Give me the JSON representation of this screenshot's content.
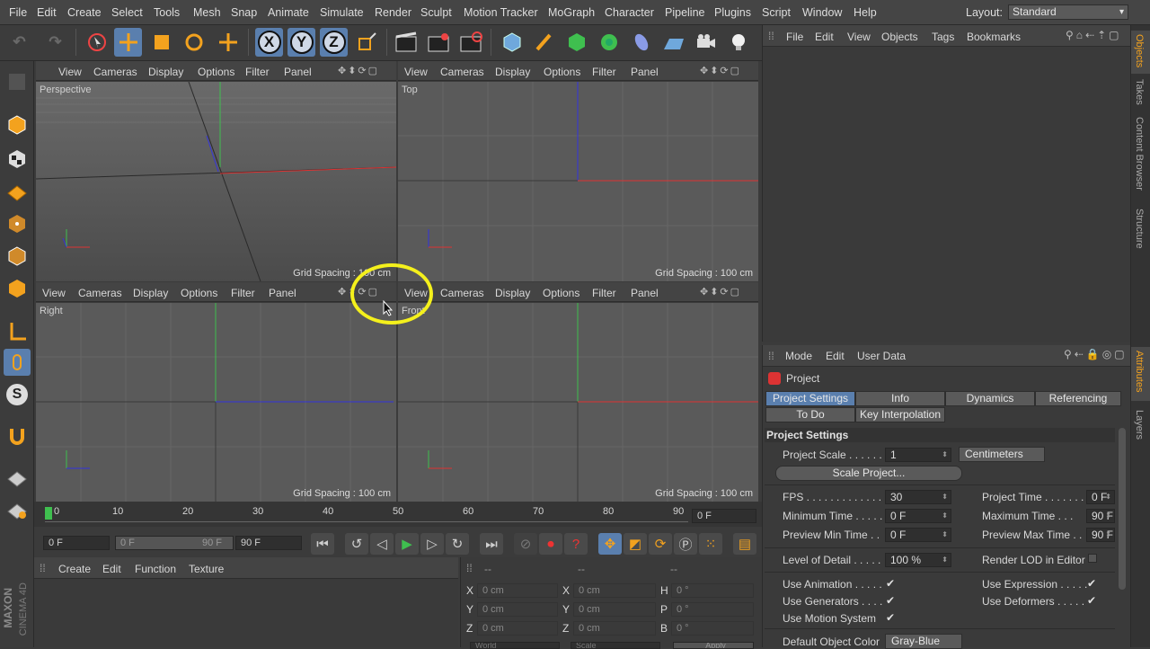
{
  "menubar": {
    "items": [
      "File",
      "Edit",
      "Create",
      "Select",
      "Tools",
      "Mesh",
      "Snap",
      "Animate",
      "Simulate",
      "Render",
      "Sculpt",
      "Motion Tracker",
      "MoGraph",
      "Character",
      "Pipeline",
      "Plugins",
      "Script",
      "Window",
      "Help"
    ],
    "layout_label": "Layout:",
    "layout_value": "Standard"
  },
  "toolbar": {
    "x": "X",
    "y": "Y",
    "z": "Z"
  },
  "viewport_menu": [
    "View",
    "Cameras",
    "Display",
    "Options",
    "Filter",
    "Panel"
  ],
  "viewports": [
    {
      "name": "Perspective",
      "grid": "Grid Spacing : 100 cm"
    },
    {
      "name": "Top",
      "grid": "Grid Spacing : 100 cm"
    },
    {
      "name": "Right",
      "grid": "Grid Spacing : 100 cm"
    },
    {
      "name": "Front",
      "grid": "Grid Spacing : 100 cm"
    }
  ],
  "timeline": {
    "ticks": [
      "0",
      "10",
      "20",
      "30",
      "40",
      "50",
      "60",
      "70",
      "80",
      "90"
    ],
    "current": "0 F"
  },
  "playback": {
    "start": "0 F",
    "range_start": "0 F",
    "range_end": "90 F",
    "end": "90 F"
  },
  "material_menu": [
    "Create",
    "Edit",
    "Function",
    "Texture"
  ],
  "coords": {
    "header": [
      "--",
      "--",
      "--"
    ],
    "rows": [
      {
        "a": "X",
        "av": "0 cm",
        "b": "X",
        "bv": "0 cm",
        "c": "H",
        "cv": "0 °"
      },
      {
        "a": "Y",
        "av": "0 cm",
        "b": "Y",
        "bv": "0 cm",
        "c": "P",
        "cv": "0 °"
      },
      {
        "a": "Z",
        "av": "0 cm",
        "b": "Z",
        "bv": "0 cm",
        "c": "B",
        "cv": "0 °"
      }
    ],
    "buttons": [
      "World",
      "Scale",
      "Apply"
    ]
  },
  "objmgr": {
    "menu": [
      "File",
      "Edit",
      "View",
      "Objects",
      "Tags",
      "Bookmarks"
    ]
  },
  "attr": {
    "menu": [
      "Mode",
      "Edit",
      "User Data"
    ],
    "title": "Project",
    "tabs1": [
      "Project Settings",
      "Info",
      "Dynamics",
      "Referencing"
    ],
    "tabs2": [
      "To Do",
      "Key Interpolation"
    ],
    "section": "Project Settings",
    "scale_label": "Project Scale . . . . . . .",
    "scale_value": "1",
    "scale_unit": "Centimeters",
    "scale_btn": "Scale Project...",
    "fps_label": "FPS . . . . . . . . . . . . . . .",
    "fps": "30",
    "ptime_label": "Project Time . . . . . . .",
    "ptime": "0 F",
    "mintime_label": "Minimum Time . . . . .",
    "mintime": "0 F",
    "maxtime_label": "Maximum Time . . .",
    "maxtime": "90 F",
    "pmin_label": "Preview Min Time . .",
    "pmin": "0 F",
    "pmax_label": "Preview Max Time . .",
    "pmax": "90 F",
    "lod_label": "Level of Detail . . . . .",
    "lod": "100 %",
    "rlod_label": "Render LOD in Editor",
    "useanim": "Use Animation . . . . .",
    "useexpr": "Use Expression . . . . .",
    "usegen": "Use Generators . . . .",
    "usedef": "Use Deformers . . . . .",
    "usemotion": "Use Motion System",
    "defcolor_label": "Default Object Color",
    "defcolor": "Gray-Blue",
    "check": "✔"
  },
  "rightstrip": [
    "Objects",
    "Takes",
    "Content Browser",
    "Structure",
    "Attributes",
    "Layers"
  ],
  "brand": [
    "MAXON",
    "CINEMA 4D"
  ]
}
